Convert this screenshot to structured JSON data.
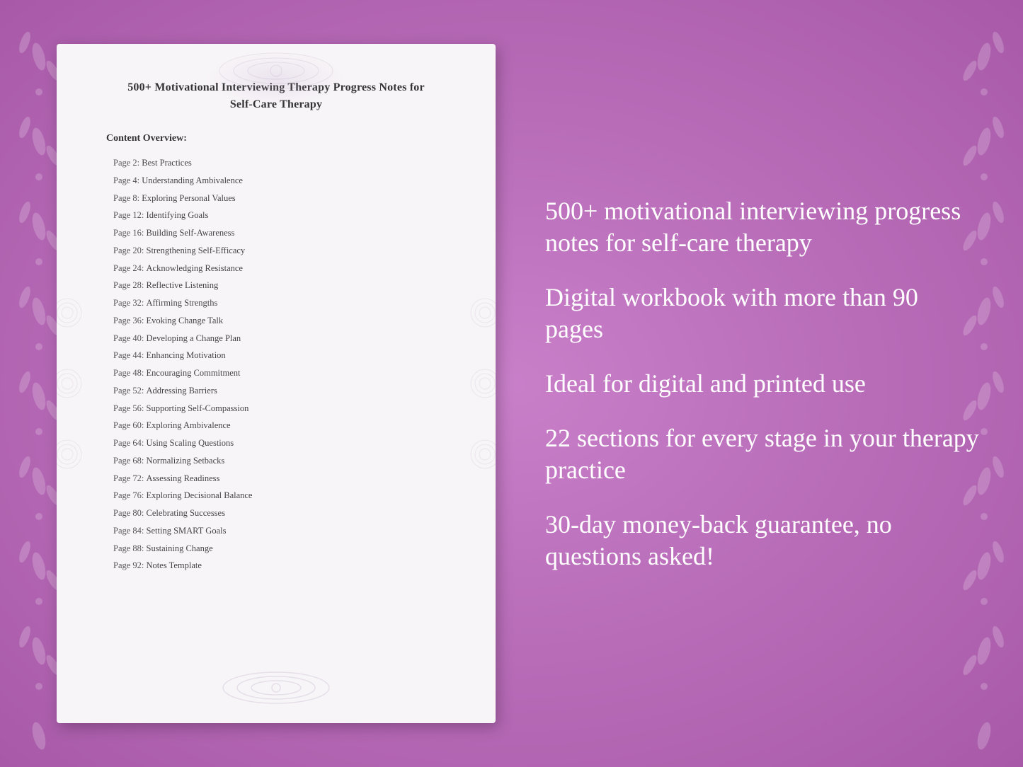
{
  "background": {
    "color": "#c078c0"
  },
  "document": {
    "title_line1": "500+ Motivational Interviewing Therapy Progress Notes for",
    "title_line2": "Self-Care Therapy",
    "content_overview_label": "Content Overview:",
    "toc": [
      {
        "page": "Page  2:",
        "topic": "Best Practices"
      },
      {
        "page": "Page  4:",
        "topic": "Understanding Ambivalence"
      },
      {
        "page": "Page  8:",
        "topic": "Exploring Personal Values"
      },
      {
        "page": "Page 12:",
        "topic": "Identifying Goals"
      },
      {
        "page": "Page 16:",
        "topic": "Building Self-Awareness"
      },
      {
        "page": "Page 20:",
        "topic": "Strengthening Self-Efficacy"
      },
      {
        "page": "Page 24:",
        "topic": "Acknowledging Resistance"
      },
      {
        "page": "Page 28:",
        "topic": "Reflective Listening"
      },
      {
        "page": "Page 32:",
        "topic": "Affirming Strengths"
      },
      {
        "page": "Page 36:",
        "topic": "Evoking Change Talk"
      },
      {
        "page": "Page 40:",
        "topic": "Developing a Change Plan"
      },
      {
        "page": "Page 44:",
        "topic": "Enhancing Motivation"
      },
      {
        "page": "Page 48:",
        "topic": "Encouraging Commitment"
      },
      {
        "page": "Page 52:",
        "topic": "Addressing Barriers"
      },
      {
        "page": "Page 56:",
        "topic": "Supporting Self-Compassion"
      },
      {
        "page": "Page 60:",
        "topic": "Exploring Ambivalence"
      },
      {
        "page": "Page 64:",
        "topic": "Using Scaling Questions"
      },
      {
        "page": "Page 68:",
        "topic": "Normalizing Setbacks"
      },
      {
        "page": "Page 72:",
        "topic": "Assessing Readiness"
      },
      {
        "page": "Page 76:",
        "topic": "Exploring Decisional Balance"
      },
      {
        "page": "Page 80:",
        "topic": "Celebrating Successes"
      },
      {
        "page": "Page 84:",
        "topic": "Setting SMART Goals"
      },
      {
        "page": "Page 88:",
        "topic": "Sustaining Change"
      },
      {
        "page": "Page 92:",
        "topic": "Notes Template"
      }
    ]
  },
  "features": [
    {
      "id": "feature1",
      "text": "500+ motivational interviewing progress notes for self-care therapy"
    },
    {
      "id": "feature2",
      "text": "Digital workbook with more than 90 pages"
    },
    {
      "id": "feature3",
      "text": "Ideal for digital and printed use"
    },
    {
      "id": "feature4",
      "text": "22 sections for every stage in your therapy practice"
    },
    {
      "id": "feature5",
      "text": "30-day money-back guarantee, no questions asked!"
    }
  ]
}
